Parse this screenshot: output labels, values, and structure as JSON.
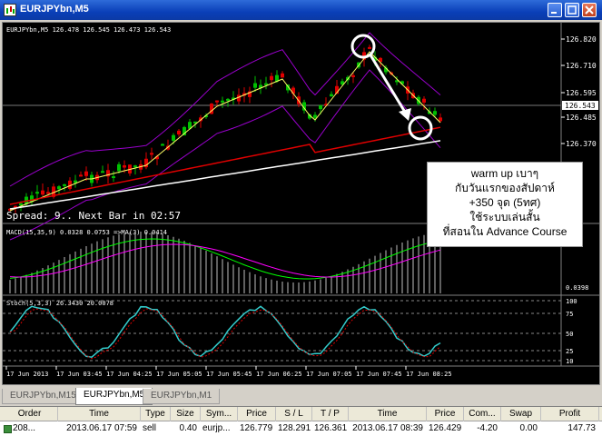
{
  "window": {
    "title": "EURJPYbn,M5",
    "colors": {
      "titlebar": "#0a3fb8",
      "bull": "#00c000",
      "bear": "#e00000",
      "band": "#9900cc"
    }
  },
  "chart": {
    "info": "EURJPYbn,M5  126.478 126.545 126.473 126.543",
    "spread_text": "Spread: 9.. Next Bar in 02:57",
    "current_price": "126.543",
    "price_ticks": [
      "126.820",
      "126.710",
      "126.595",
      "126.485",
      "126.370"
    ],
    "macd_label": "MACD(15,35,9) 0.0328 0.0753 =>MA(3) 0.0414",
    "macd_tick": "0.0398",
    "stoch_label": "Stoch(5,3,3) 26.3430 20.0078",
    "stoch_ticks": [
      "100",
      "75",
      "50",
      "25",
      "10"
    ],
    "time_ticks": [
      "17 Jun 2013",
      "17 Jun 03:45",
      "17 Jun 04:25",
      "17 Jun 05:05",
      "17 Jun 05:45",
      "17 Jun 06:25",
      "17 Jun 07:05",
      "17 Jun 07:45",
      "17 Jun 08:25"
    ],
    "annotation": [
      "warm up เบาๆ",
      "กับวันแรกของสัปดาห์",
      "+350 จุด (5ทศ)",
      "ใช้ระบบเล่นสั้น",
      "ที่สอนใน Advance Course"
    ]
  },
  "tabs": [
    {
      "label": "EURJPYbn,M15"
    },
    {
      "label": "EURJPYbn,M5"
    },
    {
      "label": "EURJPYbn,M1"
    }
  ],
  "terminal": {
    "headers": [
      "Order",
      "Time",
      "Type",
      "Size",
      "Sym...",
      "Price",
      "S / L",
      "T / P",
      "Time",
      "Price",
      "Com...",
      "Swap",
      "Profit"
    ],
    "row": [
      "208...",
      "2013.06.17 07:59",
      "sell",
      "0.40",
      "eurjp...",
      "126.779",
      "128.291",
      "126.361",
      "2013.06.17 08:39",
      "126.429",
      "-4.20",
      "0.00",
      "147.73"
    ]
  }
}
